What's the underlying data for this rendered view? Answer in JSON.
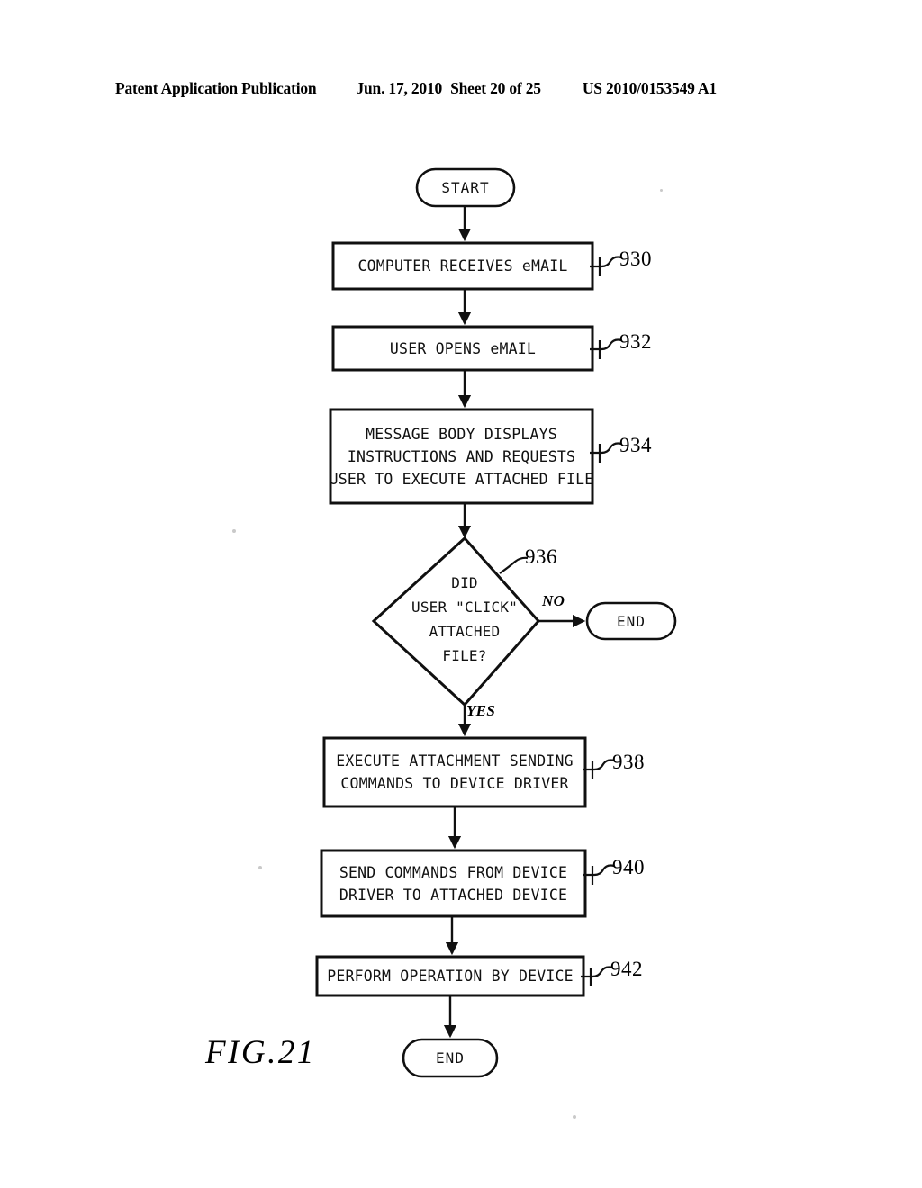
{
  "header": {
    "publication": "Patent Application Publication",
    "date": "Jun. 17, 2010",
    "sheet": "Sheet 20 of 25",
    "patent_number": "US 2010/0153549 A1"
  },
  "figure": {
    "caption": "FIG.21",
    "type": "flowchart"
  },
  "flowchart": {
    "nodes": [
      {
        "id": "start",
        "shape": "terminal",
        "label": "START"
      },
      {
        "id": "n930",
        "shape": "process",
        "label": "COMPUTER RECEIVES eMAIL",
        "ref": "930"
      },
      {
        "id": "n932",
        "shape": "process",
        "label": "USER OPENS eMAIL",
        "ref": "932"
      },
      {
        "id": "n934",
        "shape": "process",
        "ref": "934",
        "lines": [
          "MESSAGE BODY DISPLAYS",
          "INSTRUCTIONS AND REQUESTS",
          "USER TO EXECUTE ATTACHED FILE"
        ]
      },
      {
        "id": "n936",
        "shape": "decision",
        "ref": "936",
        "lines": [
          "DID",
          "USER \"CLICK\"",
          "ATTACHED",
          "FILE?"
        ]
      },
      {
        "id": "end_no",
        "shape": "terminal",
        "label": "END"
      },
      {
        "id": "n938",
        "shape": "process",
        "ref": "938",
        "lines": [
          "EXECUTE ATTACHMENT SENDING",
          "COMMANDS TO DEVICE DRIVER"
        ]
      },
      {
        "id": "n940",
        "shape": "process",
        "ref": "940",
        "lines": [
          "SEND COMMANDS FROM DEVICE",
          "DRIVER TO ATTACHED DEVICE"
        ]
      },
      {
        "id": "n942",
        "shape": "process",
        "label": "PERFORM OPERATION BY DEVICE",
        "ref": "942"
      },
      {
        "id": "end_yes",
        "shape": "terminal",
        "label": "END"
      }
    ],
    "branch_labels": {
      "no": "NO",
      "yes": "YES"
    },
    "line_color": "#101010"
  }
}
